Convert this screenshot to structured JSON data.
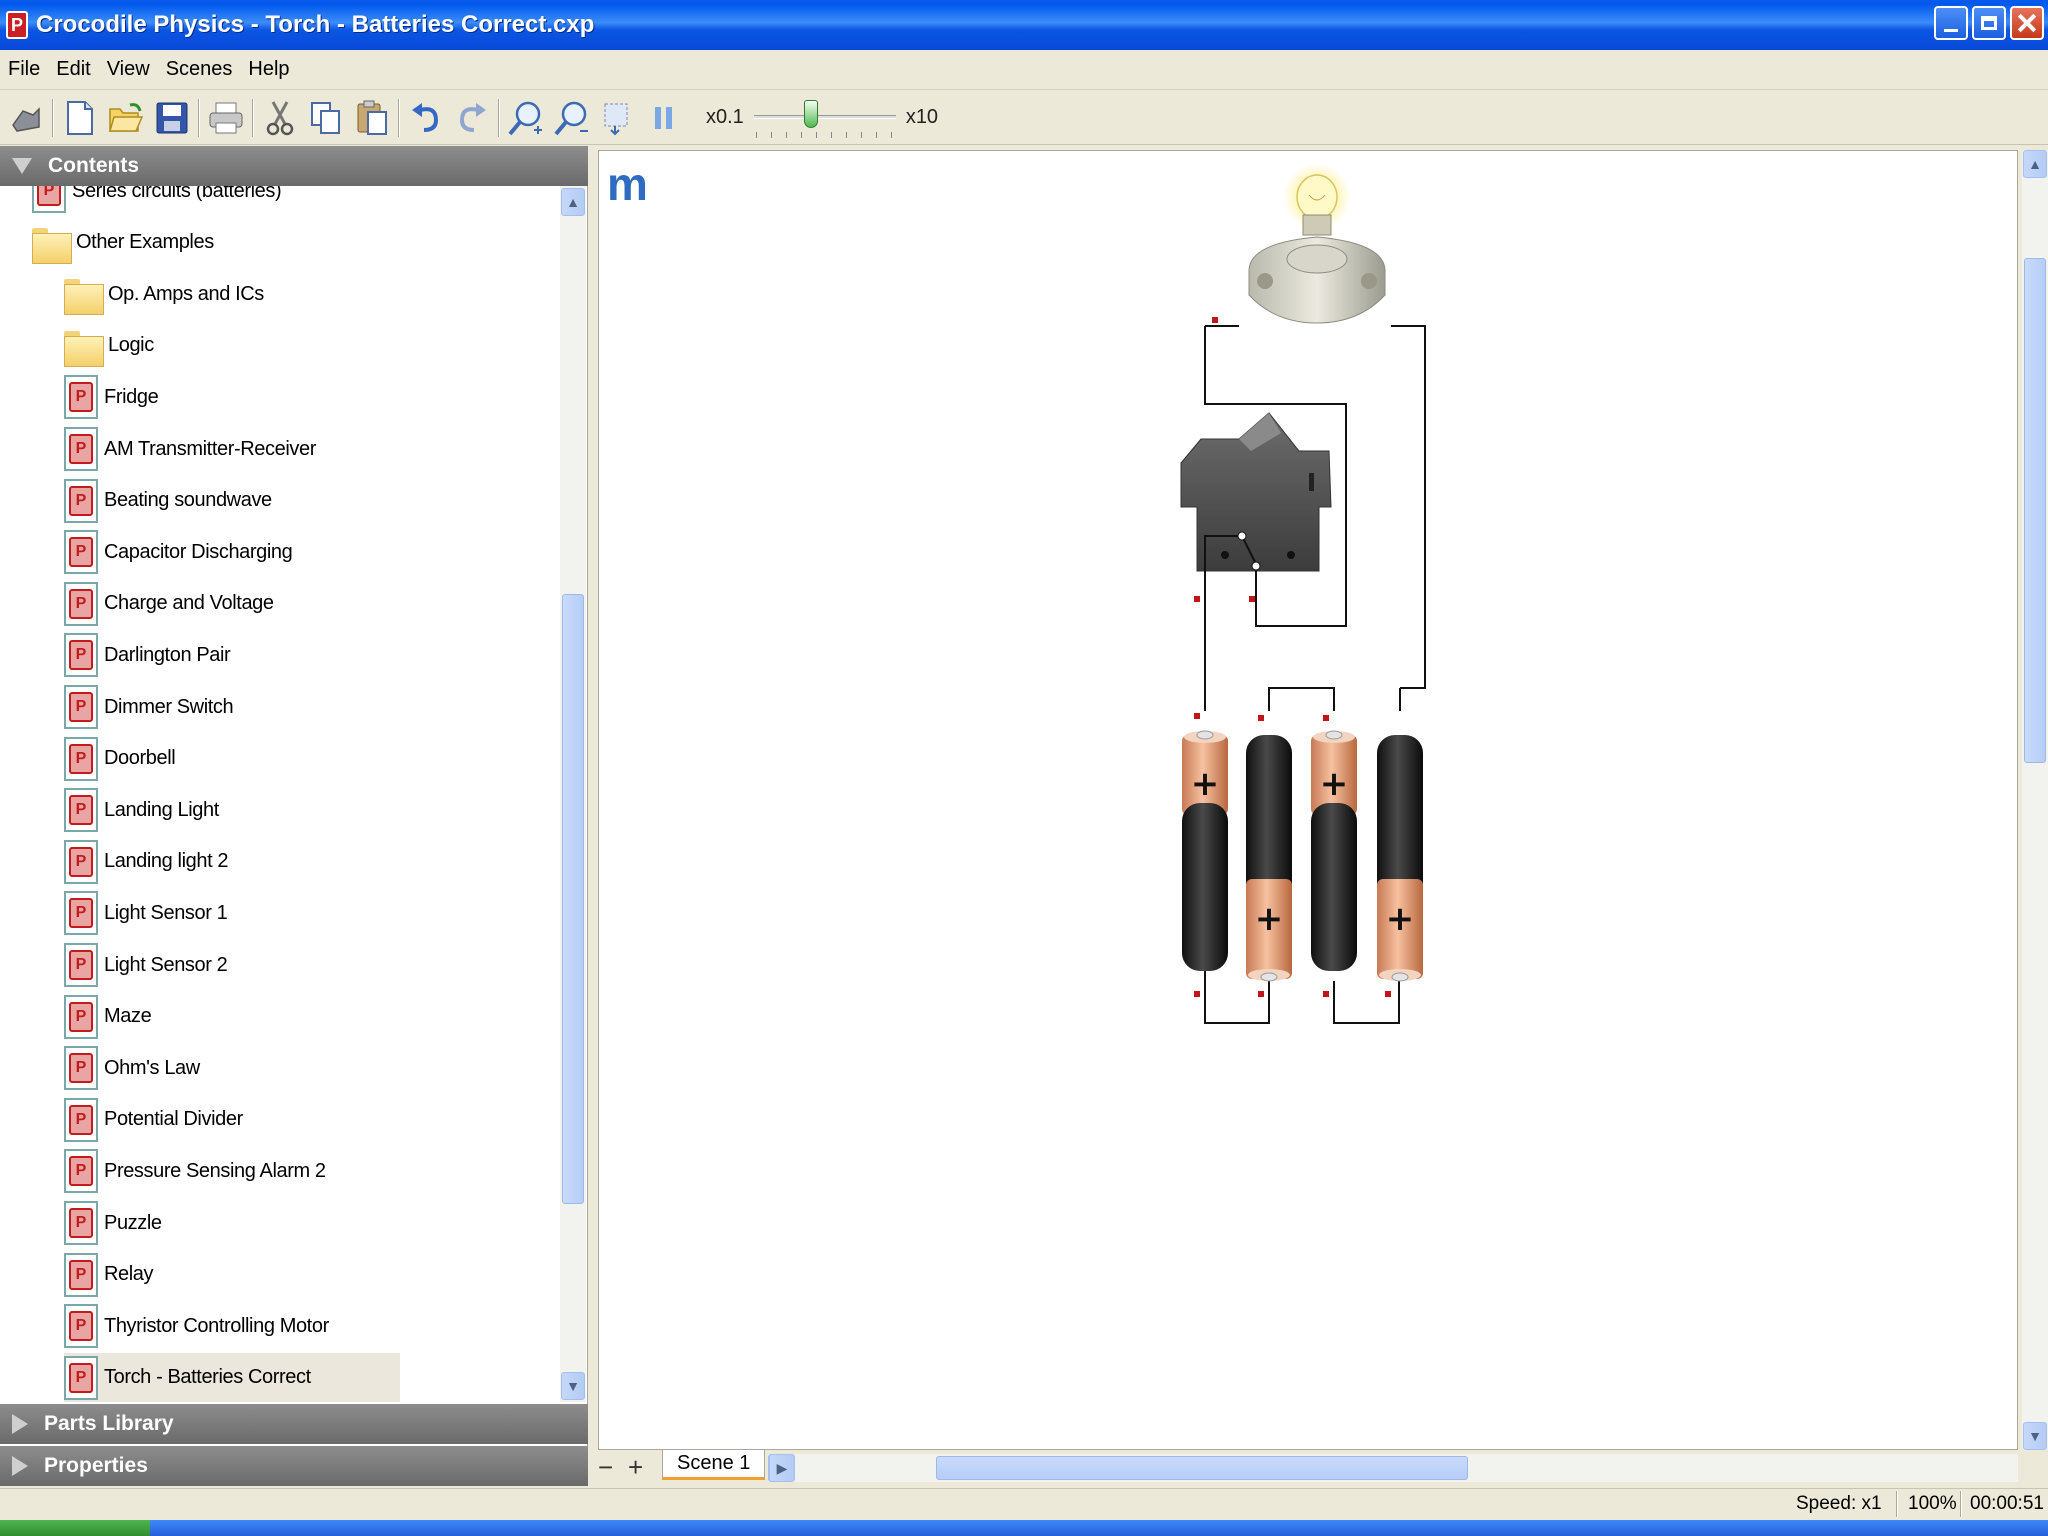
{
  "window": {
    "title": "Crocodile Physics - Torch - Batteries Correct.cxp",
    "app_icon": "P"
  },
  "menu": [
    "File",
    "Edit",
    "View",
    "Scenes",
    "Help"
  ],
  "toolbar": {
    "icons": [
      "cursor-icon",
      "new-icon",
      "open-icon",
      "save-icon",
      "print-icon",
      "cut-icon",
      "copy-icon",
      "paste-icon",
      "undo-icon",
      "redo-icon",
      "zoom-in-icon",
      "zoom-out-icon",
      "fit-icon",
      "pause-icon"
    ],
    "speed_min": "x0.1",
    "speed_max": "x10",
    "speed_level": 0.4
  },
  "left_panel": {
    "contents_title": "Contents",
    "parts_title": "Parts Library",
    "properties_title": "Properties",
    "tree": [
      {
        "label": "Series circuits (batteries)",
        "type": "doc",
        "indent": 1,
        "partial": true
      },
      {
        "label": "Other Examples",
        "type": "folder",
        "indent": 1
      },
      {
        "label": "Op. Amps and ICs",
        "type": "folder",
        "indent": 2
      },
      {
        "label": "Logic",
        "type": "folder",
        "indent": 2
      },
      {
        "label": "Fridge",
        "type": "doc",
        "indent": 2
      },
      {
        "label": "AM Transmitter-Receiver",
        "type": "doc",
        "indent": 2
      },
      {
        "label": "Beating soundwave",
        "type": "doc",
        "indent": 2
      },
      {
        "label": "Capacitor Discharging",
        "type": "doc",
        "indent": 2
      },
      {
        "label": "Charge and Voltage",
        "type": "doc",
        "indent": 2
      },
      {
        "label": "Darlington Pair",
        "type": "doc",
        "indent": 2
      },
      {
        "label": "Dimmer Switch",
        "type": "doc",
        "indent": 2
      },
      {
        "label": "Doorbell",
        "type": "doc",
        "indent": 2
      },
      {
        "label": "Landing Light",
        "type": "doc",
        "indent": 2
      },
      {
        "label": "Landing light 2",
        "type": "doc",
        "indent": 2
      },
      {
        "label": "Light Sensor 1",
        "type": "doc",
        "indent": 2
      },
      {
        "label": "Light Sensor 2",
        "type": "doc",
        "indent": 2
      },
      {
        "label": "Maze",
        "type": "doc",
        "indent": 2
      },
      {
        "label": "Ohm's Law",
        "type": "doc",
        "indent": 2
      },
      {
        "label": "Potential Divider",
        "type": "doc",
        "indent": 2
      },
      {
        "label": "Pressure Sensing Alarm 2",
        "type": "doc",
        "indent": 2
      },
      {
        "label": "Puzzle",
        "type": "doc",
        "indent": 2
      },
      {
        "label": "Relay",
        "type": "doc",
        "indent": 2
      },
      {
        "label": "Thyristor Controlling Motor",
        "type": "doc",
        "indent": 2
      },
      {
        "label": "Torch - Batteries Correct",
        "type": "doc",
        "indent": 2,
        "selected": true
      }
    ]
  },
  "canvas": {
    "logo": "m"
  },
  "scenes": {
    "remove": "−",
    "add": "+",
    "tabs": [
      "Scene 1"
    ]
  },
  "status": {
    "speed": "Speed: x1",
    "zoom": "100%",
    "time": "00:00:51"
  },
  "colors": {
    "title_blue": "#0a56e4",
    "battery_copper": "#e8a07a",
    "selection": "#ebe7dc"
  }
}
